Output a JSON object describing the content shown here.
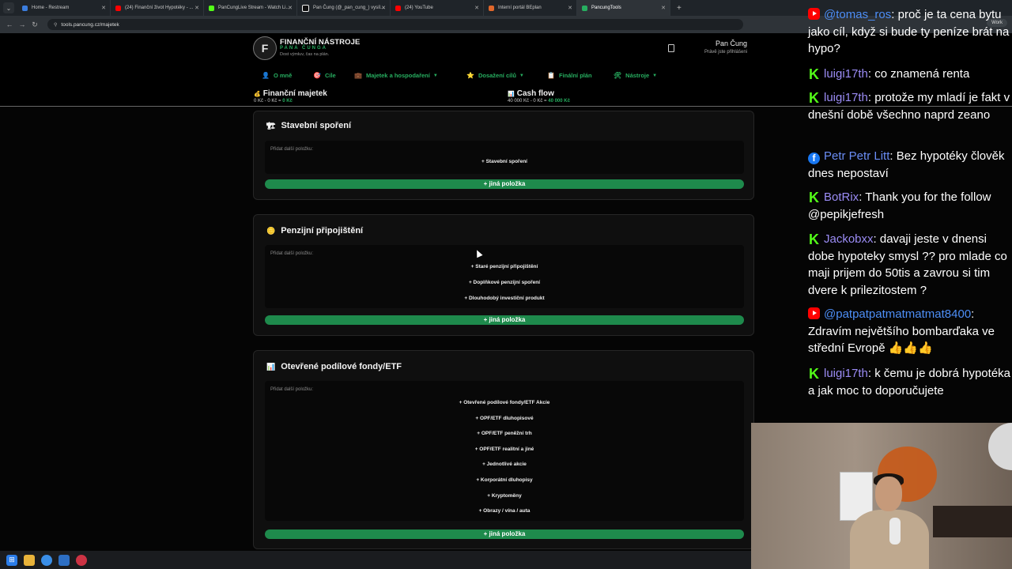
{
  "browser": {
    "tabs": [
      {
        "label": "Home - Restream",
        "color": "#3b7ddd"
      },
      {
        "label": "(24) Finanční život Hypotéky - ...",
        "color": "#ff0000"
      },
      {
        "label": "PanCungLive Stream - Watch Li...",
        "color": "#53fc18"
      },
      {
        "label": "Pan Čung (@_pan_cung_) vysíl...",
        "color": "#111111"
      },
      {
        "label": "(24) YouTube",
        "color": "#ff0000"
      },
      {
        "label": "Interní portál BEplan",
        "color": "#e0672b"
      },
      {
        "label": "PancungTools",
        "color": "#27ae60"
      }
    ],
    "url": "tools.pancung.cz/majetek",
    "profile": "Work"
  },
  "site": {
    "logo_letter": "F",
    "title": "FINANČNÍ NÁSTROJE",
    "subtitle": "PANA ČUNGA",
    "tagline": "Dost výmluv, čas na plán.",
    "user_name": "Pan Čung",
    "user_status": "Právě jste přihlášeni",
    "nav": [
      {
        "icon": "👤",
        "label": "O mně",
        "caret": ""
      },
      {
        "icon": "🎯",
        "label": "Cíle",
        "caret": ""
      },
      {
        "icon": "💼",
        "label": "Majetek a hospodaření",
        "caret": "▼"
      },
      {
        "icon": "⭐",
        "label": "Dosažení cílů",
        "caret": "▼"
      },
      {
        "icon": "📋",
        "label": "Finální plán",
        "caret": ""
      },
      {
        "icon": "🛠",
        "label": "Nástroje",
        "caret": "▼"
      }
    ],
    "summary": {
      "assets": {
        "icon": "💰",
        "title": "Finanční majetek",
        "v1": "0 Kč",
        "v2": "0 Kč",
        "v3": "0 Kč"
      },
      "cashflow": {
        "icon": "📊",
        "title": "Cash flow",
        "v1": "40 000 Kč",
        "v2": "0 Kč",
        "v3": "40 000 Kč"
      }
    }
  },
  "cards": {
    "stavebni": {
      "icon": "🏗",
      "title": "Stavební spoření",
      "add_label": "Přidat další položku:",
      "items": [
        "+ Stavební spoření"
      ],
      "other": "+ jiná položka"
    },
    "penzijni": {
      "icon": "🪙",
      "title": "Penzijní připojištění",
      "add_label": "Přidat další položku:",
      "items": [
        "+ Staré penzijní připojištění",
        "+ Doplňkové penzijní spoření",
        "+ Dlouhodobý investiční produkt"
      ],
      "other": "+ jiná položka"
    },
    "fondy": {
      "icon": "📊",
      "title": "Otevřené podílové fondy/ETF",
      "add_label": "Přidat další položku:",
      "items": [
        "+ Otevřené podílové fondy/ETF Akcie",
        "+ OPF/ETF dluhopisové",
        "+ OPF/ETF peněžní trh",
        "+ OPF/ETF realitní a jiné",
        "+ Jednotlivé akcie",
        "+ Korporátní dluhopisy",
        "+ Kryptoměny",
        "+ Obrazy / vína / auta"
      ],
      "other": "+ jiná položka"
    }
  },
  "chat": [
    {
      "platform": "yt",
      "user": "@tomas_ros",
      "color": "#4d8ef7",
      "text": "proč je ta cena bytu jako cíl, když si bude ty peníze brát na hypo?"
    },
    {
      "platform": "kick",
      "user": "luigi17th",
      "color": "#9b8cf5",
      "text": "co znamená renta"
    },
    {
      "platform": "kick",
      "user": "luigi17th",
      "color": "#9b8cf5",
      "text": "protože my mladí je fakt v dnešní době všechno naprd zeano"
    },
    {
      "platform": "fb",
      "user": "Petr Petr Litt",
      "color": "#6a8df5",
      "text": "Bez hypotéky člověk dnes nepostaví"
    },
    {
      "platform": "kick",
      "user": "BotRix",
      "color": "#9b8cf5",
      "text": "Thank you for the follow @pepikjefresh"
    },
    {
      "platform": "kick",
      "user": "Jackobxx",
      "color": "#9b8cf5",
      "text": "davaji jeste v dnensi dobe hypoteky smysl ?? pro mlade co maji prijem do 50tis a zavrou si tim dvere k prilezitostem ?"
    },
    {
      "platform": "yt",
      "user": "@patpatpatmatmatmat8400",
      "color": "#4d8ef7",
      "text": "Zdravím největšího bombarďaka ve střední Evropě 👍👍👍"
    },
    {
      "platform": "kick",
      "user": "luigi17th",
      "color": "#9b8cf5",
      "text": "k čemu je dobrá hypotéka a jak moc to doporučujete"
    }
  ]
}
